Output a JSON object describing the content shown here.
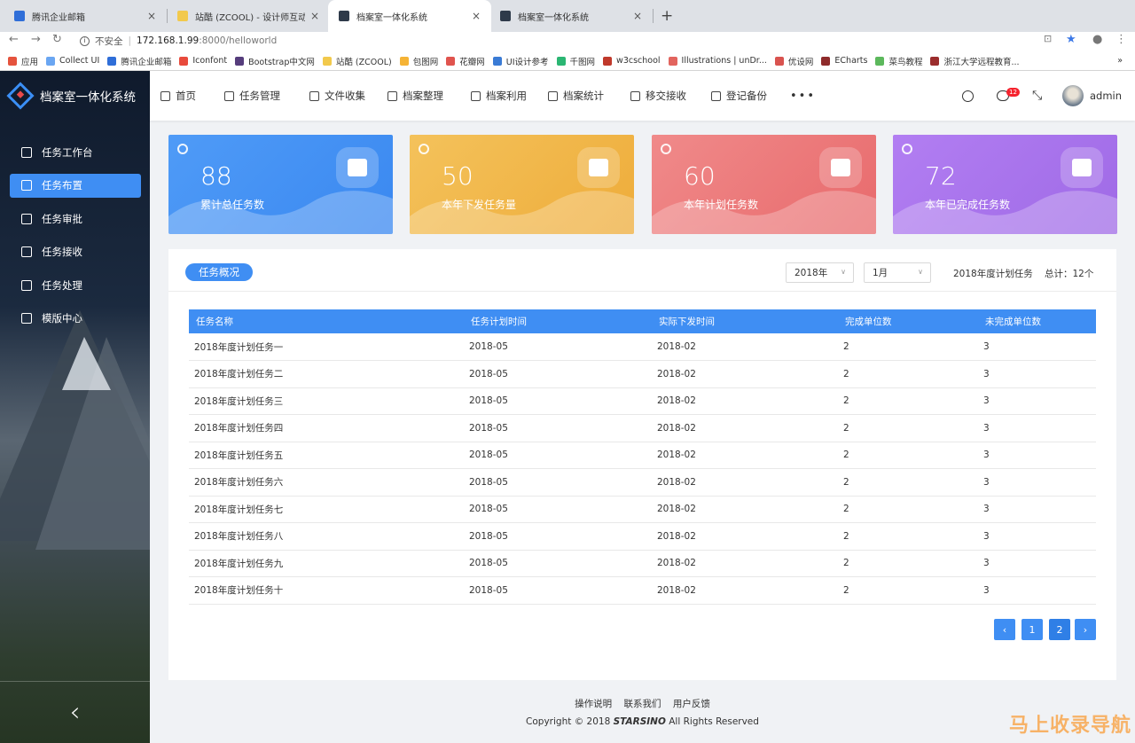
{
  "browser": {
    "tabs": [
      {
        "title": "腾讯企业邮箱",
        "favicon_color": "#2f6ed8"
      },
      {
        "title": "站酷 (ZCOOL) - 设计师互动平台",
        "favicon_color": "#f2c94c"
      },
      {
        "title": "档案室一体化系统",
        "favicon_color": "#2e3a4a"
      },
      {
        "title": "档案室一体化系统",
        "favicon_color": "#2e3a4a"
      }
    ],
    "close_glyph": "×",
    "new_tab_glyph": "+",
    "security_label": "不安全",
    "url_host": "172.168.1.99",
    "url_path": ":8000/helloworld",
    "bookmarks": [
      {
        "label": "应用",
        "color": "#e5533d"
      },
      {
        "label": "Collect UI",
        "color": "#6aa6f2"
      },
      {
        "label": "腾讯企业邮箱",
        "color": "#2f6ed8"
      },
      {
        "label": "Iconfont",
        "color": "#e84a3c"
      },
      {
        "label": "Bootstrap中文网",
        "color": "#563d7c"
      },
      {
        "label": "站酷 (ZCOOL)",
        "color": "#f2c94c"
      },
      {
        "label": "包图网",
        "color": "#f5b335"
      },
      {
        "label": "花瓣网",
        "color": "#e0544e"
      },
      {
        "label": "UI设计参考",
        "color": "#3a7bd5"
      },
      {
        "label": "千图网",
        "color": "#2bb673"
      },
      {
        "label": "w3cschool",
        "color": "#c0392b"
      },
      {
        "label": "Illustrations | unDr...",
        "color": "#e2645e"
      },
      {
        "label": "优设网",
        "color": "#d9534f"
      },
      {
        "label": "ECharts",
        "color": "#8e2b2b"
      },
      {
        "label": "菜鸟教程",
        "color": "#5cb85c"
      },
      {
        "label": "浙江大学远程教育...",
        "color": "#9b2d2d"
      }
    ],
    "more_bookmarks": "»"
  },
  "app": {
    "title": "档案室一体化系统",
    "accent": "#3f8ef3",
    "sidebar": {
      "items": [
        {
          "label": "任务工作台",
          "active": false
        },
        {
          "label": "任务布置",
          "active": true
        },
        {
          "label": "任务审批",
          "active": false
        },
        {
          "label": "任务接收",
          "active": false
        },
        {
          "label": "任务处理",
          "active": false
        },
        {
          "label": "模版中心",
          "active": false
        }
      ],
      "collapse_glyph": "‹"
    },
    "topnav": {
      "items": [
        "首页",
        "任务管理",
        "文件收集",
        "档案整理",
        "档案利用",
        "档案统计",
        "移交接收",
        "登记备份"
      ],
      "more": "•••",
      "message_badge": "12",
      "username": "admin"
    },
    "stats": [
      {
        "value": "88",
        "label": "累计总任务数",
        "color_from": "#4f9bf7",
        "color_to": "#3a88f0"
      },
      {
        "value": "50",
        "label": "本年下发任务量",
        "color_from": "#f4c25b",
        "color_to": "#eeac3a"
      },
      {
        "value": "60",
        "label": "本年计划任务数",
        "color_from": "#f08a8a",
        "color_to": "#e86a6c"
      },
      {
        "value": "72",
        "label": "本年已完成任务数",
        "color_from": "#b27ef2",
        "color_to": "#9f6ae6"
      }
    ],
    "overview": {
      "title": "任务概况",
      "year_select": "2018年",
      "month_select": "1月",
      "plan_label": "2018年度计划任务",
      "total_label": "总计：12个",
      "columns": [
        "任务名称",
        "任务计划时间",
        "实际下发时间",
        "完成单位数",
        "未完成单位数"
      ],
      "rows": [
        [
          "2018年度计划任务一",
          "2018-05",
          "2018-02",
          "2",
          "3"
        ],
        [
          "2018年度计划任务二",
          "2018-05",
          "2018-02",
          "2",
          "3"
        ],
        [
          "2018年度计划任务三",
          "2018-05",
          "2018-02",
          "2",
          "3"
        ],
        [
          "2018年度计划任务四",
          "2018-05",
          "2018-02",
          "2",
          "3"
        ],
        [
          "2018年度计划任务五",
          "2018-05",
          "2018-02",
          "2",
          "3"
        ],
        [
          "2018年度计划任务六",
          "2018-05",
          "2018-02",
          "2",
          "3"
        ],
        [
          "2018年度计划任务七",
          "2018-05",
          "2018-02",
          "2",
          "3"
        ],
        [
          "2018年度计划任务八",
          "2018-05",
          "2018-02",
          "2",
          "3"
        ],
        [
          "2018年度计划任务九",
          "2018-05",
          "2018-02",
          "2",
          "3"
        ],
        [
          "2018年度计划任务十",
          "2018-05",
          "2018-02",
          "2",
          "3"
        ]
      ],
      "pagination": {
        "prev": "‹",
        "pages": [
          "1",
          "2"
        ],
        "next": "›",
        "current": "2"
      }
    },
    "footer": {
      "links": [
        "操作说明",
        "联系我们",
        "用户反馈"
      ],
      "copyright_prefix": "Copyright © 2018",
      "brand": "STARSINO",
      "copyright_suffix": "All Rights Reserved"
    },
    "watermark": "马上收录导航"
  }
}
